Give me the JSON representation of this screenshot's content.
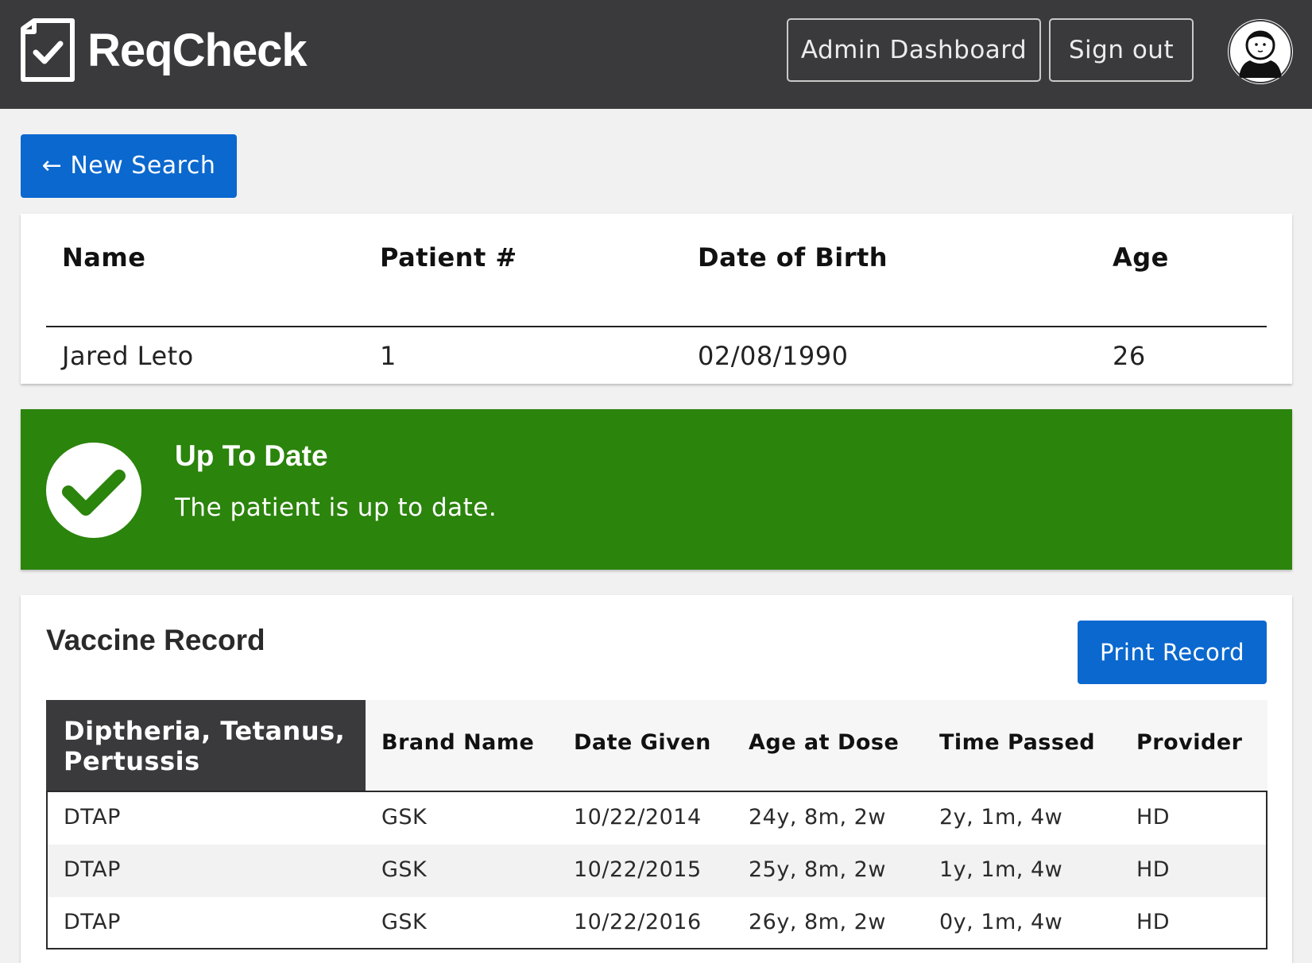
{
  "header": {
    "brand": "ReqCheck",
    "admin_label": "Admin Dashboard",
    "signout_label": "Sign out",
    "logo_icon": "clipboard-check-icon",
    "avatar_icon": "user-avatar-icon",
    "bg_color": "#3a3a3d"
  },
  "new_search": {
    "label": "← New Search"
  },
  "patient": {
    "headers": [
      "Name",
      "Patient #",
      "Date of Birth",
      "Age"
    ],
    "values": [
      "Jared Leto",
      "1",
      "02/08/1990",
      "26"
    ]
  },
  "status": {
    "title": "Up To Date",
    "text": "The patient is up to date.",
    "icon": "checkmark-icon",
    "color": "#2b840c"
  },
  "vaccine_record": {
    "title": "Vaccine Record",
    "print_label": "Print Record",
    "group": {
      "name": "Diptheria, Tetanus, Pertussis",
      "columns": [
        "Brand Name",
        "Date Given",
        "Age at Dose",
        "Time Passed",
        "Provider"
      ],
      "rows": [
        [
          "DTAP",
          "GSK",
          "10/22/2014",
          "24y, 8m, 2w",
          "2y, 1m, 4w",
          "HD"
        ],
        [
          "DTAP",
          "GSK",
          "10/22/2015",
          "25y, 8m, 2w",
          "1y, 1m, 4w",
          "HD"
        ],
        [
          "DTAP",
          "GSK",
          "10/22/2016",
          "26y, 8m, 2w",
          "0y, 1m, 4w",
          "HD"
        ]
      ]
    }
  },
  "accent_color": "#0a68cf"
}
